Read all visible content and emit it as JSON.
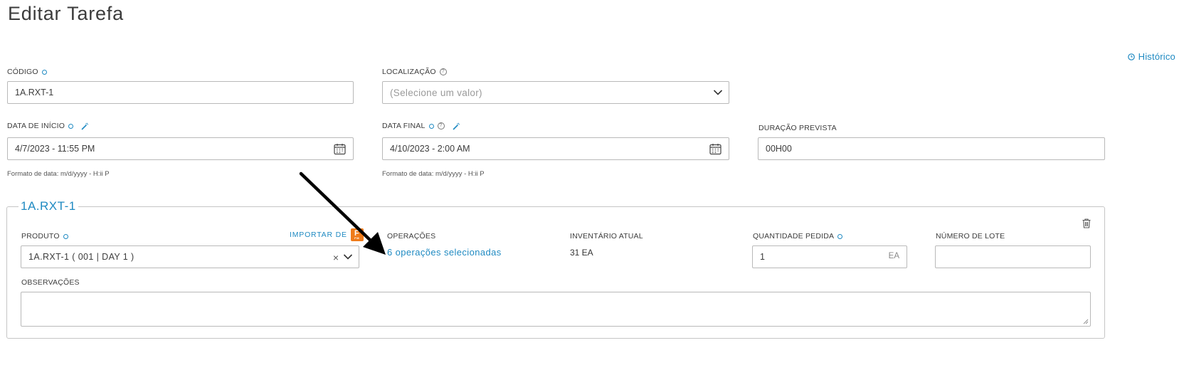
{
  "page": {
    "title": "Editar Tarefa"
  },
  "history": {
    "label": "Histórico",
    "icon": "clock-icon"
  },
  "fields": {
    "codigo": {
      "label": "CÓDIGO",
      "value": "1A.RXT-1"
    },
    "localizacao": {
      "label": "LOCALIZAÇÃO",
      "placeholder": "(Selecione um valor)"
    },
    "data_inicio": {
      "label": "DATA DE INÍCIO",
      "value": "4/7/2023 - 11:55 PM",
      "hint": "Formato de data: m/d/yyyy - H:ii P"
    },
    "data_final": {
      "label": "DATA FINAL",
      "value": "4/10/2023 - 2:00 AM",
      "hint": "Formato de data: m/d/yyyy - H:ii P"
    },
    "duracao": {
      "label": "DURAÇÃO PREVISTA",
      "value": "00H00"
    }
  },
  "item": {
    "legend": "1A.RXT-1",
    "produto": {
      "label": "PRODUTO",
      "value": "1A.RXT-1 ( 001 | DAY 1 )"
    },
    "importar": {
      "label": "IMPORTAR DE",
      "badge_letter": "F",
      "badge_sub": "FM"
    },
    "operacoes": {
      "label": "OPERAÇÕES",
      "link": "6 operações selecionadas"
    },
    "inventario": {
      "label": "INVENTÁRIO ATUAL",
      "value": "31 EA"
    },
    "quantidade": {
      "label": "QUANTIDADE PEDIDA",
      "value": "1",
      "unit": "EA"
    },
    "lote": {
      "label": "NÚMERO DE LOTE",
      "value": ""
    },
    "observacoes": {
      "label": "OBSERVAÇÕES",
      "value": ""
    }
  },
  "colors": {
    "accent": "#1f8ac2",
    "border": "#b9b9b9",
    "text": "#3c3c3c",
    "badge": "#ef7b1a"
  }
}
